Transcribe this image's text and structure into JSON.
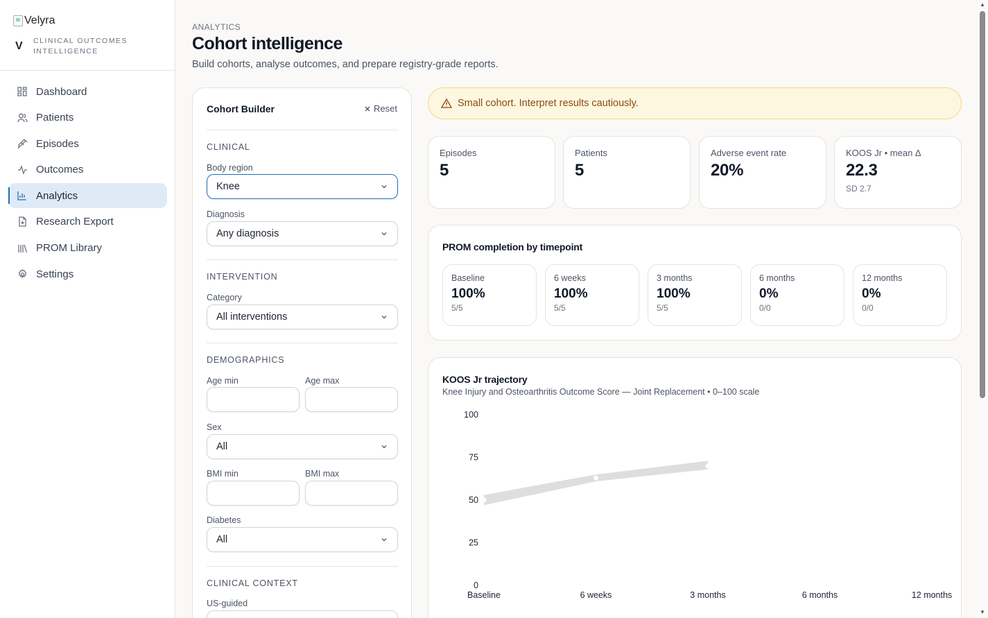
{
  "brand": {
    "logo_alt": "Velyra",
    "mark": "V",
    "tagline": "CLINICAL OUTCOMES INTELLIGENCE"
  },
  "nav": {
    "items": [
      {
        "label": "Dashboard",
        "icon": "grid-icon"
      },
      {
        "label": "Patients",
        "icon": "users-icon"
      },
      {
        "label": "Episodes",
        "icon": "syringe-icon"
      },
      {
        "label": "Outcomes",
        "icon": "activity-icon"
      },
      {
        "label": "Analytics",
        "icon": "bar-chart-icon",
        "active": true
      },
      {
        "label": "Research Export",
        "icon": "file-export-icon"
      },
      {
        "label": "PROM Library",
        "icon": "library-icon"
      },
      {
        "label": "Settings",
        "icon": "gear-icon"
      }
    ]
  },
  "header": {
    "eyebrow": "ANALYTICS",
    "title": "Cohort intelligence",
    "subtitle": "Build cohorts, analyse outcomes, and prepare registry-grade reports."
  },
  "builder": {
    "title": "Cohort Builder",
    "reset_label": "Reset",
    "clinical": {
      "section": "CLINICAL",
      "body_region_label": "Body region",
      "body_region_value": "Knee",
      "diagnosis_label": "Diagnosis",
      "diagnosis_value": "Any diagnosis"
    },
    "intervention": {
      "section": "INTERVENTION",
      "category_label": "Category",
      "category_value": "All interventions"
    },
    "demographics": {
      "section": "DEMOGRAPHICS",
      "age_min_label": "Age min",
      "age_max_label": "Age max",
      "sex_label": "Sex",
      "sex_value": "All",
      "bmi_min_label": "BMI min",
      "bmi_max_label": "BMI max",
      "diabetes_label": "Diabetes",
      "diabetes_value": "All"
    },
    "context": {
      "section": "CLINICAL CONTEXT",
      "us_guided_label": "US-guided"
    }
  },
  "warning": {
    "text": "Small cohort. Interpret results cautiously.",
    "color": "#fef7e0"
  },
  "stats": [
    {
      "label": "Episodes",
      "value": "5"
    },
    {
      "label": "Patients",
      "value": "5"
    },
    {
      "label": "Adverse event rate",
      "value": "20%"
    },
    {
      "label": "KOOS Jr • mean Δ",
      "value": "22.3",
      "sub": "SD 2.7"
    }
  ],
  "completion": {
    "title": "PROM completion by timepoint",
    "timepoints": [
      {
        "label": "Baseline",
        "value": "100%",
        "sub": "5/5"
      },
      {
        "label": "6 weeks",
        "value": "100%",
        "sub": "5/5"
      },
      {
        "label": "3 months",
        "value": "100%",
        "sub": "5/5"
      },
      {
        "label": "6 months",
        "value": "0%",
        "sub": "0/0"
      },
      {
        "label": "12 months",
        "value": "0%",
        "sub": "0/0"
      }
    ]
  },
  "trajectory": {
    "title": "KOOS Jr trajectory",
    "subtitle": "Knee Injury and Osteoarthritis Outcome Score — Joint Replacement • 0–100 scale"
  },
  "chart_data": {
    "type": "line",
    "title": "KOOS Jr trajectory",
    "categories": [
      "Baseline",
      "6 weeks",
      "3 months",
      "6 months",
      "12 months"
    ],
    "y_ticks": [
      "100",
      "75",
      "50",
      "25",
      "0"
    ],
    "ylim": [
      0,
      100
    ],
    "series": [
      {
        "mean": [
          50,
          63,
          70,
          null,
          null
        ],
        "band_low": [
          47,
          61,
          68,
          null,
          null
        ],
        "band_high": [
          53,
          65,
          73,
          null,
          null
        ]
      }
    ],
    "color": "#dedede",
    "grid": false
  }
}
